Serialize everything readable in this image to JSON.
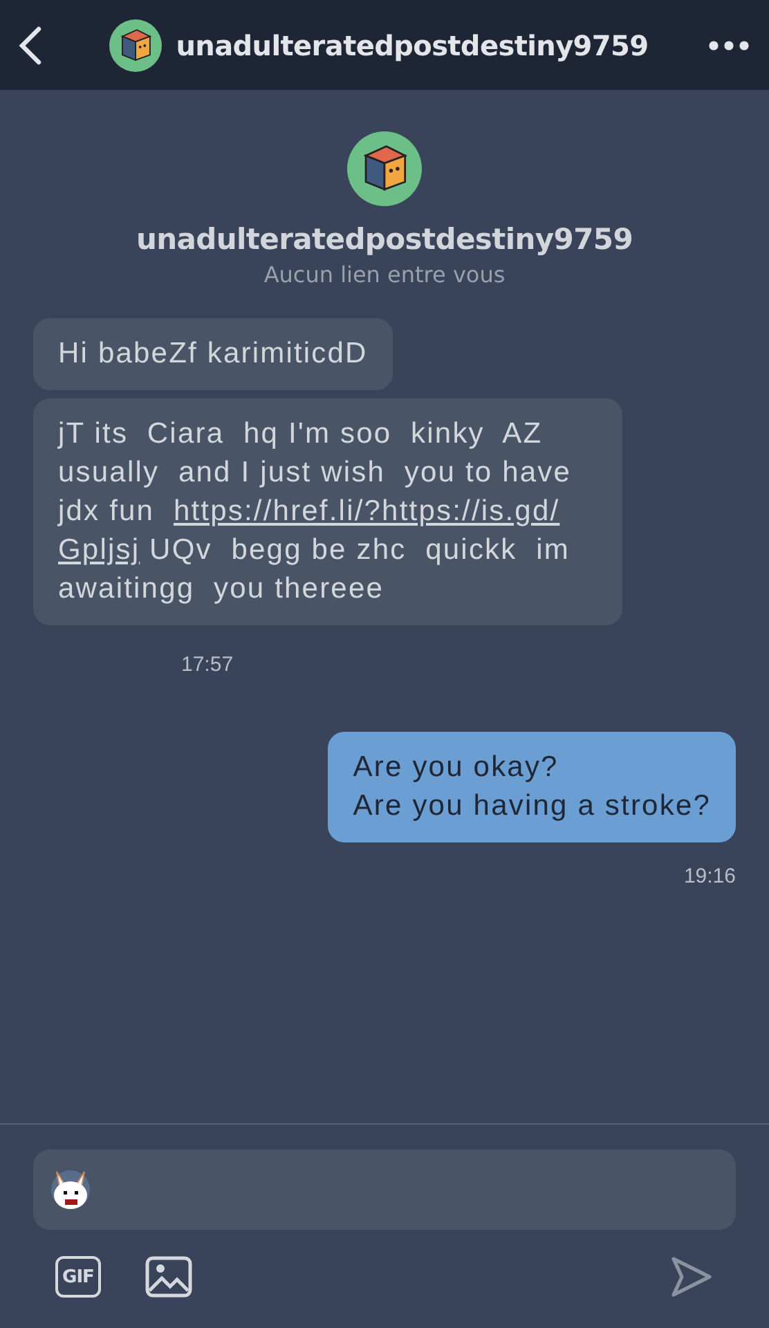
{
  "header": {
    "title": "unadulteratedpostdestiny9759"
  },
  "profile": {
    "name": "unadulteratedpostdestiny9759",
    "subtitle": "Aucun lien entre vous"
  },
  "messages": [
    {
      "kind": "received",
      "parts": [
        {
          "kind": "text",
          "text": "Hi babeZf karimiticdD"
        }
      ]
    },
    {
      "kind": "received",
      "parts": [
        {
          "kind": "text",
          "text": "jT its  Ciara  hq I'm soo  kinky  AZ usually  and I just wish  you to have jdx fun  "
        },
        {
          "kind": "link",
          "text": "https://href.li/?https://is.gd/"
        },
        {
          "kind": "link",
          "text": "Gpljsj"
        },
        {
          "kind": "text",
          "text": " UQv  begg be zhc  quickk  im awaitingg  you thereee"
        }
      ]
    },
    {
      "kind": "received_time",
      "text": "17:57"
    },
    {
      "kind": "sent",
      "parts": [
        {
          "kind": "text",
          "text": "Are you okay?\nAre you having a stroke?"
        }
      ]
    },
    {
      "kind": "sent_time",
      "text": "19:16"
    }
  ],
  "composer": {
    "gif_label": "GIF"
  }
}
